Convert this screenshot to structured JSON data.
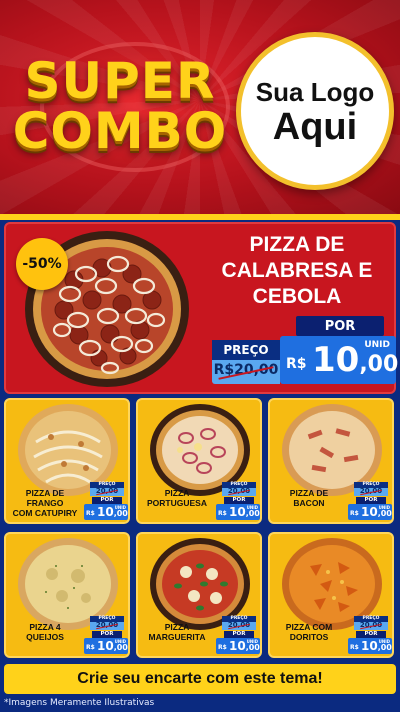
{
  "header": {
    "title_line1": "SUPER",
    "title_line2": "COMBO",
    "logo_line1": "Sua Logo",
    "logo_line2": "Aqui"
  },
  "featured": {
    "discount": "-50%",
    "name_lines": [
      "PIZZA DE",
      "CALABRESA E",
      "CEBOLA"
    ],
    "price_label": "PREÇO",
    "old_price": "R$20,00",
    "por_label": "POR",
    "currency": "R$",
    "new_price_int": "10",
    "new_price_cents": ",00",
    "unit_label": "UNID",
    "pizza_icon": "calabresa-onion-pizza-image"
  },
  "products": [
    {
      "name_lines": [
        "PIZZA DE FRANGO",
        "COM CATUPIRY"
      ],
      "price_label": "PREÇO",
      "old_price": "20,00",
      "por_label": "POR",
      "currency": "R$",
      "price_int": "10",
      "price_cents": ",00",
      "unit_label": "UNID",
      "pizza_icon": "chicken-catupiry-pizza-image"
    },
    {
      "name_lines": [
        "PIZZA",
        "PORTUGUESA"
      ],
      "price_label": "PREÇO",
      "old_price": "20,00",
      "por_label": "POR",
      "currency": "R$",
      "price_int": "10",
      "price_cents": ",00",
      "unit_label": "UNID",
      "pizza_icon": "portuguesa-pizza-image"
    },
    {
      "name_lines": [
        "PIZZA DE",
        "BACON"
      ],
      "price_label": "PREÇO",
      "old_price": "20,00",
      "por_label": "POR",
      "currency": "R$",
      "price_int": "10",
      "price_cents": ",00",
      "unit_label": "UNID",
      "pizza_icon": "bacon-pizza-image"
    },
    {
      "name_lines": [
        "PIZZA 4",
        "QUEIJOS"
      ],
      "price_label": "PREÇO",
      "old_price": "20,00",
      "por_label": "POR",
      "currency": "R$",
      "price_int": "10",
      "price_cents": ",00",
      "unit_label": "UNID",
      "pizza_icon": "four-cheese-pizza-image"
    },
    {
      "name_lines": [
        "PIZZA",
        "MARGUERITA"
      ],
      "price_label": "PREÇO",
      "old_price": "20,00",
      "por_label": "POR",
      "currency": "R$",
      "price_int": "10",
      "price_cents": ",00",
      "unit_label": "UNID",
      "pizza_icon": "margherita-pizza-image"
    },
    {
      "name_lines": [
        "PIZZA COM",
        "DORITOS"
      ],
      "price_label": "PREÇO",
      "old_price": "20,00",
      "por_label": "POR",
      "currency": "R$",
      "price_int": "10",
      "price_cents": ",00",
      "unit_label": "UNID",
      "pizza_icon": "doritos-pizza-image"
    }
  ],
  "cta": "Crie seu encarte com este tema!",
  "footnote": "*Imagens Meramente Ilustrativas",
  "colors": {
    "header_red": "#c8161f",
    "gold": "#ffd21a",
    "card_yellow": "#f6bb12",
    "background_blue": "#0b2a80",
    "price_blue": "#1f6fe0",
    "old_price_blue": "#5aa8f0"
  }
}
